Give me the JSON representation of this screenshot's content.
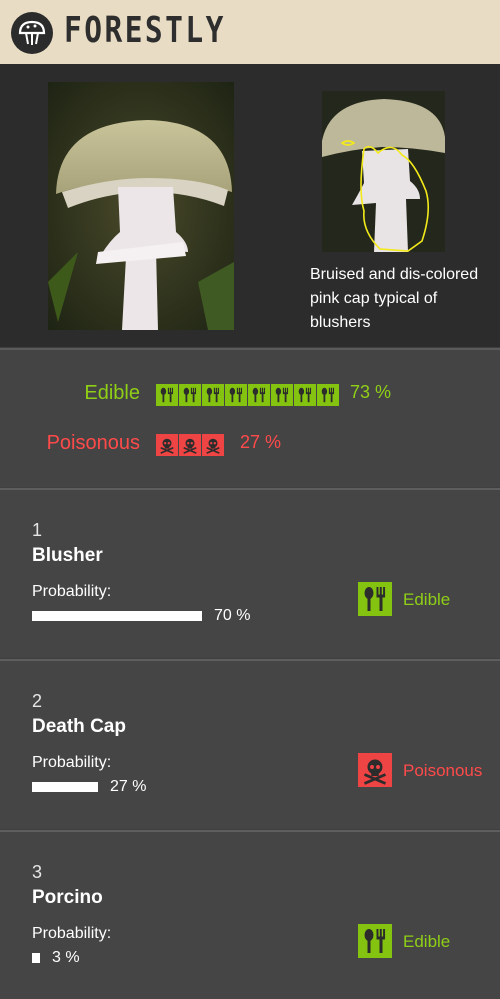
{
  "app": {
    "name": "FORESTLY",
    "logo_icon": "mushroom-logo-icon"
  },
  "hero": {
    "caption": "Bruised and dis-colored pink cap typical of blushers"
  },
  "summary": {
    "edible": {
      "label": "Edible",
      "percent": "73 %",
      "icon_count": 8,
      "color": "#8fcf16"
    },
    "poisonous": {
      "label": "Poisonous",
      "percent": "27 %",
      "icon_count": 3,
      "color": "#ff4a4a"
    }
  },
  "species": [
    {
      "rank": "1",
      "name": "Blusher",
      "prob_label": "Probability:",
      "probability": 0.7,
      "percent": "70 %",
      "tag": "Edible",
      "tag_icon": "cutlery-icon",
      "tag_color": "#8fcf16"
    },
    {
      "rank": "2",
      "name": "Death Cap",
      "prob_label": "Probability:",
      "probability": 0.27,
      "percent": "27 %",
      "tag": "Poisonous",
      "tag_icon": "skull-icon",
      "tag_color": "#ff4a4a"
    },
    {
      "rank": "3",
      "name": "Porcino",
      "prob_label": "Probability:",
      "probability": 0.03,
      "percent": "3 %",
      "tag": "Edible",
      "tag_icon": "cutlery-icon",
      "tag_color": "#8fcf16"
    }
  ]
}
